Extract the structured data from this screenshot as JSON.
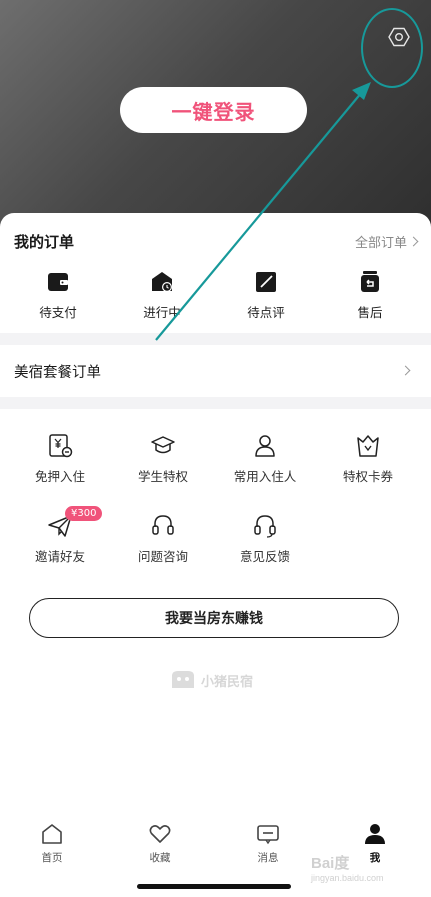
{
  "header": {
    "login_label": "一键登录"
  },
  "orders": {
    "title": "我的订单",
    "all_label": "全部订单",
    "items": [
      {
        "label": "待支付",
        "icon": "wallet-icon"
      },
      {
        "label": "进行中",
        "icon": "in-progress-icon"
      },
      {
        "label": "待点评",
        "icon": "review-icon"
      },
      {
        "label": "售后",
        "icon": "after-sales-icon"
      }
    ]
  },
  "package": {
    "title": "美宿套餐订单"
  },
  "services": [
    {
      "label": "免押入住",
      "icon": "deposit-free-icon"
    },
    {
      "label": "学生特权",
      "icon": "graduation-cap-icon"
    },
    {
      "label": "常用入住人",
      "icon": "person-icon"
    },
    {
      "label": "特权卡券",
      "icon": "crown-coupon-icon"
    },
    {
      "label": "邀请好友",
      "icon": "paper-plane-icon",
      "badge": "¥300"
    },
    {
      "label": "问题咨询",
      "icon": "headset-icon"
    },
    {
      "label": "意见反馈",
      "icon": "headset-icon"
    }
  ],
  "host_button": "我要当房东赚钱",
  "brand": "小猪民宿",
  "tabs": [
    {
      "label": "首页",
      "icon": "home-icon"
    },
    {
      "label": "收藏",
      "icon": "heart-icon"
    },
    {
      "label": "消息",
      "icon": "message-icon"
    },
    {
      "label": "我",
      "icon": "profile-icon",
      "active": true
    }
  ],
  "watermark": {
    "main": "Bai度",
    "sub": "jingyan.baidu.com"
  },
  "colors": {
    "accent": "#f0537a",
    "annotation": "#17999a"
  }
}
